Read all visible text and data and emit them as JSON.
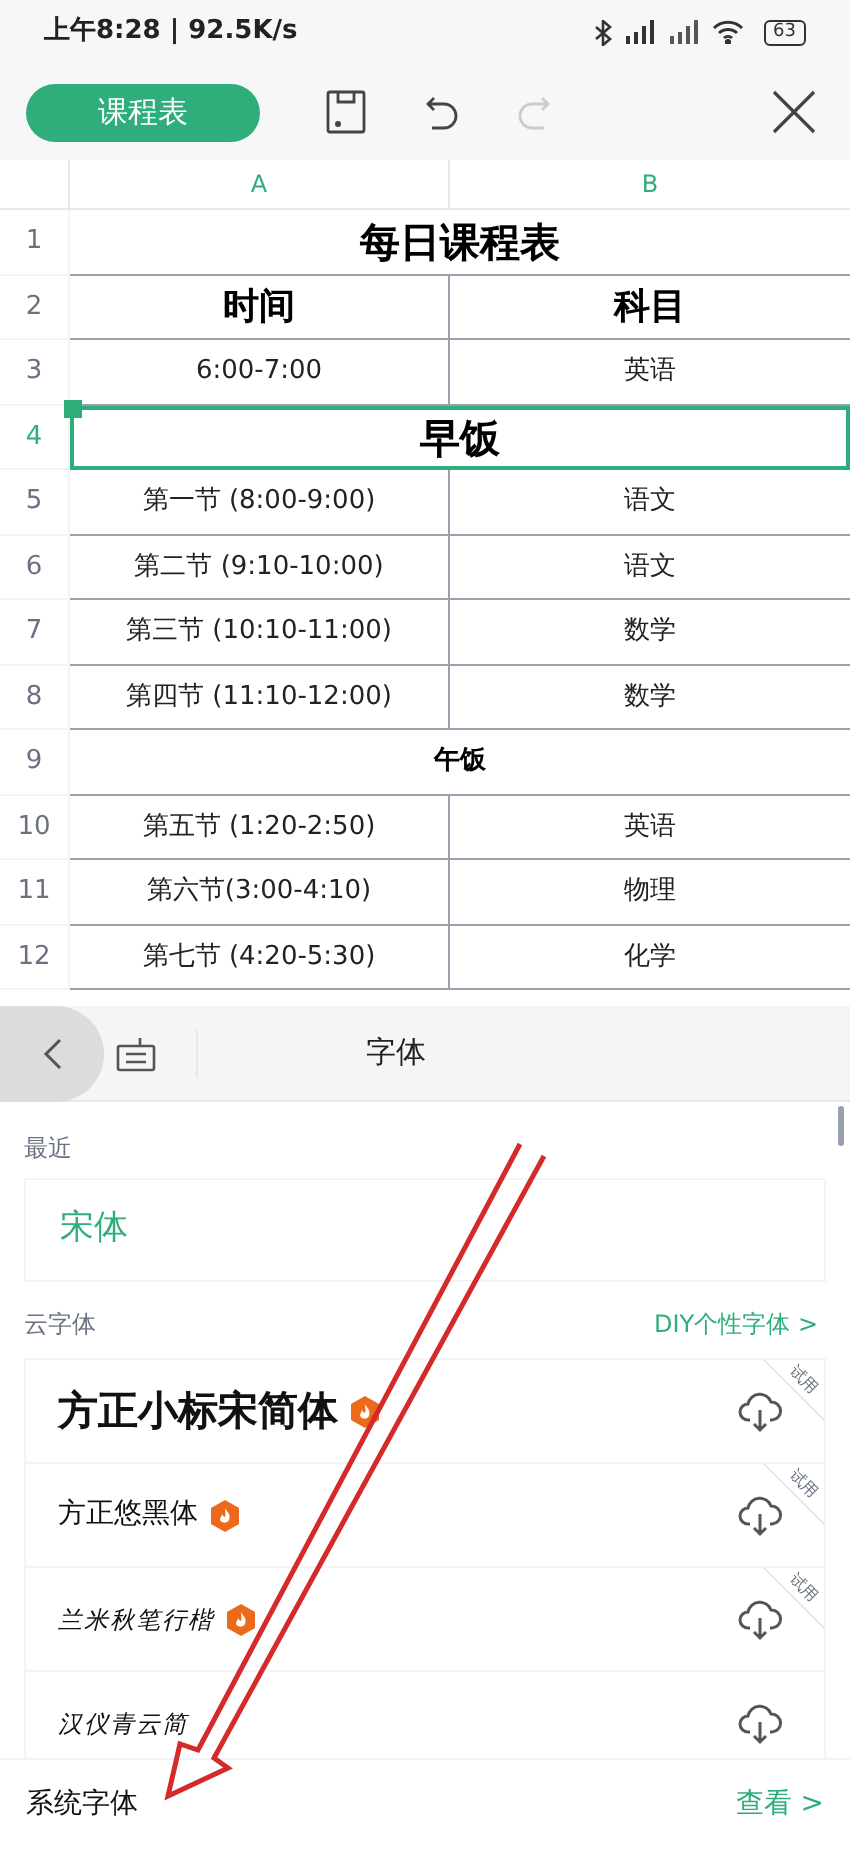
{
  "status_bar": {
    "time": "上午8:28 | 92.5K/s",
    "battery": "63"
  },
  "toolbar": {
    "file_name": "课程表"
  },
  "sheet": {
    "columns": [
      {
        "label": "A"
      },
      {
        "label": "B"
      }
    ],
    "rows": [
      {
        "number": "1",
        "kind": "title",
        "selected": false,
        "cells": [
          "每日课程表"
        ]
      },
      {
        "number": "2",
        "kind": "header",
        "selected": false,
        "cells": [
          "时间",
          "科目"
        ]
      },
      {
        "number": "3",
        "kind": "cell",
        "selected": false,
        "cells": [
          "6:00-7:00",
          "英语"
        ]
      },
      {
        "number": "4",
        "kind": "title",
        "selected": true,
        "cells": [
          "早饭"
        ]
      },
      {
        "number": "5",
        "kind": "cell",
        "selected": false,
        "cells": [
          "第一节 (8:00-9:00)",
          "语文"
        ]
      },
      {
        "number": "6",
        "kind": "cell",
        "selected": false,
        "cells": [
          "第二节 (9:10-10:00)",
          "语文"
        ]
      },
      {
        "number": "7",
        "kind": "cell",
        "selected": false,
        "cells": [
          "第三节 (10:10-11:00)",
          "数学"
        ]
      },
      {
        "number": "8",
        "kind": "cell",
        "selected": false,
        "cells": [
          "第四节 (11:10-12:00)",
          "数学"
        ]
      },
      {
        "number": "9",
        "kind": "section",
        "selected": false,
        "cells": [
          "午饭"
        ]
      },
      {
        "number": "10",
        "kind": "cell",
        "selected": false,
        "cells": [
          "第五节 (1:20-2:50)",
          "英语"
        ]
      },
      {
        "number": "11",
        "kind": "cell",
        "selected": false,
        "cells": [
          "第六节(3:00-4:10)",
          "物理"
        ]
      },
      {
        "number": "12",
        "kind": "cell",
        "selected": false,
        "cells": [
          "第七节 (4:20-5:30)",
          "化学"
        ]
      }
    ]
  },
  "font_panel": {
    "title": "字体",
    "recent_label": "最近",
    "recent_font": "宋体",
    "cloud_label": "云字体",
    "diy_link": "DIY个性字体 >",
    "fonts": [
      {
        "name": "方正小标宋简体",
        "kind": "large",
        "premium": true,
        "trial": "试用"
      },
      {
        "name": "方正悠黑体",
        "kind": "normal",
        "premium": true,
        "trial": "试用"
      },
      {
        "name": "兰米秋笔行楷",
        "kind": "script",
        "premium": true,
        "trial": "试用"
      },
      {
        "name": "汉仪青云简",
        "kind": "script",
        "premium": false
      }
    ],
    "system_label": "系统字体",
    "view_link": "查看 >"
  }
}
